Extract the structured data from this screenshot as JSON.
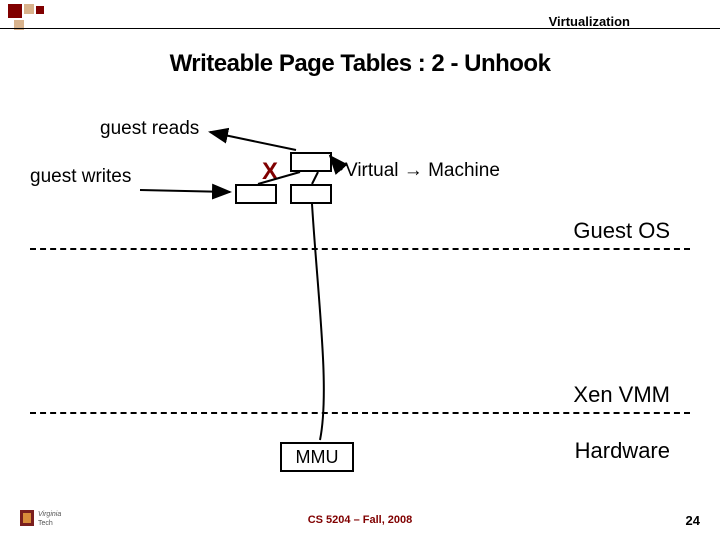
{
  "header": {
    "section": "Virtualization"
  },
  "title": "Writeable Page Tables : 2 - Unhook",
  "labels": {
    "guest_reads": "guest reads",
    "guest_writes": "guest writes",
    "virtual_machine": "Virtual → Machine",
    "x": "X"
  },
  "layers": {
    "guest_os": "Guest OS",
    "xen_vmm": "Xen VMM",
    "hardware": "Hardware"
  },
  "mmu": {
    "label": "MMU"
  },
  "footer": {
    "course": "CS 5204 – Fall, 2008"
  },
  "page": "24",
  "logo": {
    "text1": "Virginia",
    "text2": "Tech"
  }
}
